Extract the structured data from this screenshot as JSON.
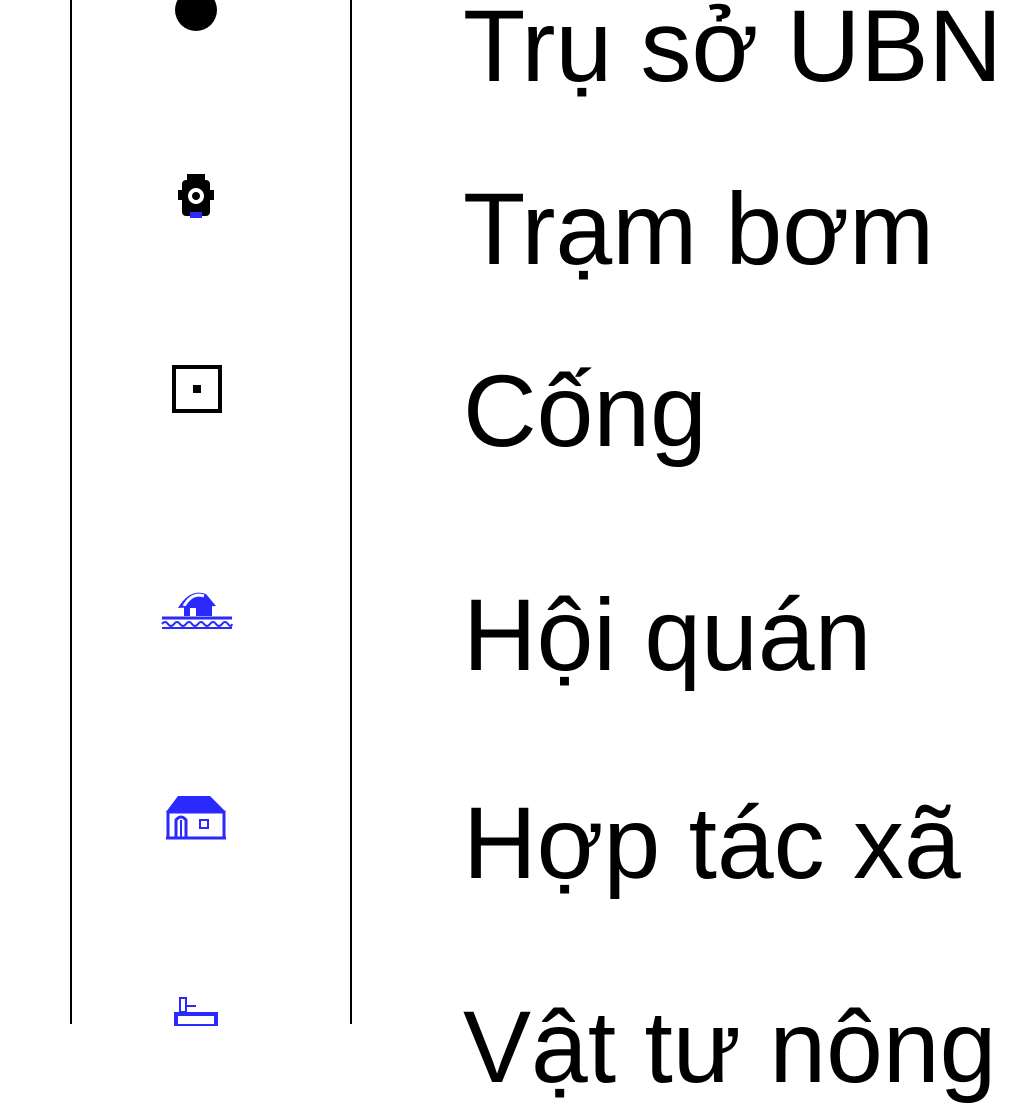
{
  "legend": {
    "items": [
      {
        "icon": "dot-icon",
        "label": "Trụ sở UBN"
      },
      {
        "icon": "pump-station-icon",
        "label": "Trạm bơm"
      },
      {
        "icon": "culvert-icon",
        "label": "Cống"
      },
      {
        "icon": "meeting-hall-icon",
        "label": "Hội quán"
      },
      {
        "icon": "cooperative-house-icon",
        "label": "Hợp tác xã"
      },
      {
        "icon": "agricultural-supplies-icon",
        "label": "Vật tư nông"
      }
    ]
  },
  "colors": {
    "icon_blue": "#1a1aff",
    "line": "#000000"
  }
}
